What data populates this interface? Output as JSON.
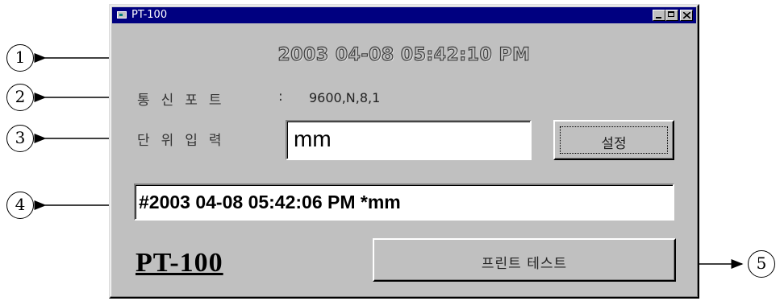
{
  "window": {
    "title": "PT-100"
  },
  "datetime_display": "2003 04-08 05:42:10 PM",
  "port": {
    "label": "통신포트",
    "colon": ":",
    "value": "9600,N,8,1"
  },
  "unit": {
    "label": "단위입력",
    "input_value": "mm",
    "set_button_label": "설정"
  },
  "log": {
    "value": "#2003 04-08 05:42:06 PM *mm"
  },
  "brand": "PT-100",
  "print_test_button_label": "프린트 테스트",
  "callouts": [
    "1",
    "2",
    "3",
    "4",
    "5"
  ]
}
